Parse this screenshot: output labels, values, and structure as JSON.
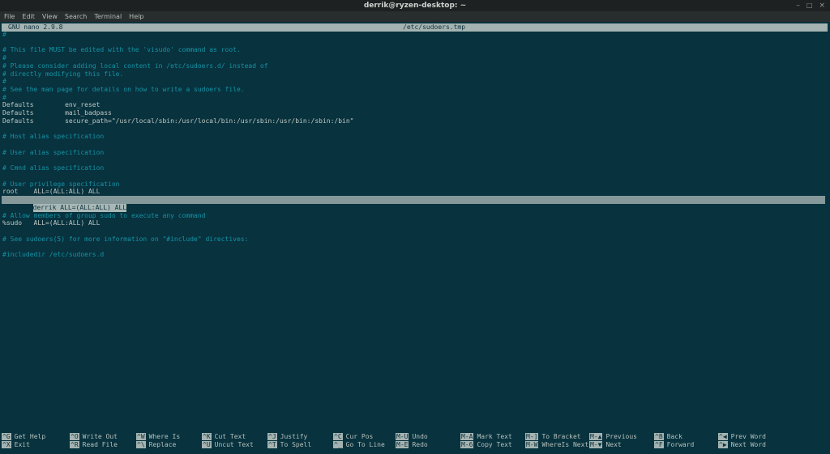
{
  "window": {
    "title": "derrik@ryzen-desktop: ~",
    "controls": {
      "minimize_icon": "–",
      "maximize_icon": "□",
      "close_icon": "×"
    }
  },
  "menu": {
    "items": [
      "File",
      "Edit",
      "View",
      "Search",
      "Terminal",
      "Help"
    ]
  },
  "palette": {
    "terminal-bg": "#07323e",
    "comment": "#1693a5",
    "text": "#c1c8c3",
    "bar-bg": "#a4b3b1",
    "bar-text": "#0f323c",
    "hl-row": "#85989a",
    "hl-text-bg": "#a8b8b6",
    "titlebar-bg": "#1d2121",
    "menubar-bg": "#282d2d"
  },
  "nano": {
    "version_label": "GNU nano 2.9.8",
    "filename": "/etc/sudoers.tmp",
    "current_line_index": 21,
    "lines": [
      {
        "text": "#",
        "kind": "comment"
      },
      {
        "text": "",
        "kind": "blank"
      },
      {
        "text": "# This file MUST be edited with the 'visudo' command as root.",
        "kind": "comment"
      },
      {
        "text": "#",
        "kind": "comment"
      },
      {
        "text": "# Please consider adding local content in /etc/sudoers.d/ instead of",
        "kind": "comment"
      },
      {
        "text": "# directly modifying this file.",
        "kind": "comment"
      },
      {
        "text": "#",
        "kind": "comment"
      },
      {
        "text": "# See the man page for details on how to write a sudoers file.",
        "kind": "comment"
      },
      {
        "text": "#",
        "kind": "comment"
      },
      {
        "text": "Defaults        env_reset",
        "kind": "plain"
      },
      {
        "text": "Defaults        mail_badpass",
        "kind": "plain"
      },
      {
        "text": "Defaults        secure_path=\"/usr/local/sbin:/usr/local/bin:/usr/sbin:/usr/bin:/sbin:/bin\"",
        "kind": "plain"
      },
      {
        "text": "",
        "kind": "blank"
      },
      {
        "text": "# Host alias specification",
        "kind": "comment"
      },
      {
        "text": "",
        "kind": "blank"
      },
      {
        "text": "# User alias specification",
        "kind": "comment"
      },
      {
        "text": "",
        "kind": "blank"
      },
      {
        "text": "# Cmnd alias specification",
        "kind": "comment"
      },
      {
        "text": "",
        "kind": "blank"
      },
      {
        "text": "# User privilege specification",
        "kind": "comment"
      },
      {
        "text": "root    ALL=(ALL:ALL) ALL",
        "kind": "plain"
      },
      {
        "text": "derrik ALL=(ALL:ALL) ALL",
        "kind": "highlight"
      },
      {
        "text": "",
        "kind": "blank"
      },
      {
        "text": "# Allow members of group sudo to execute any command",
        "kind": "comment"
      },
      {
        "text": "%sudo   ALL=(ALL:ALL) ALL",
        "kind": "plain"
      },
      {
        "text": "",
        "kind": "blank"
      },
      {
        "text": "# See sudoers(5) for more information on \"#include\" directives:",
        "kind": "comment"
      },
      {
        "text": "",
        "kind": "blank"
      },
      {
        "text": "#includedir /etc/sudoers.d",
        "kind": "comment"
      }
    ],
    "shortcuts": [
      {
        "top": {
          "key": "^G",
          "label": "Get Help"
        },
        "bottom": {
          "key": "^X",
          "label": "Exit"
        }
      },
      {
        "top": {
          "key": "^O",
          "label": "Write Out"
        },
        "bottom": {
          "key": "^R",
          "label": "Read File"
        }
      },
      {
        "top": {
          "key": "^W",
          "label": "Where Is"
        },
        "bottom": {
          "key": "^\\",
          "label": "Replace"
        }
      },
      {
        "top": {
          "key": "^K",
          "label": "Cut Text"
        },
        "bottom": {
          "key": "^U",
          "label": "Uncut Text"
        }
      },
      {
        "top": {
          "key": "^J",
          "label": "Justify"
        },
        "bottom": {
          "key": "^T",
          "label": "To Spell"
        }
      },
      {
        "top": {
          "key": "^C",
          "label": "Cur Pos"
        },
        "bottom": {
          "key": "^_",
          "label": "Go To Line"
        }
      },
      {
        "top": {
          "key": "M-U",
          "label": "Undo"
        },
        "bottom": {
          "key": "M-E",
          "label": "Redo"
        }
      },
      {
        "top": {
          "key": "M-A",
          "label": "Mark Text"
        },
        "bottom": {
          "key": "M-6",
          "label": "Copy Text"
        }
      },
      {
        "top": {
          "key": "M-]",
          "label": "To Bracket"
        },
        "bottom": {
          "key": "M-W",
          "label": "WhereIs Next"
        }
      },
      {
        "top": {
          "key": "M-▲",
          "label": "Previous"
        },
        "bottom": {
          "key": "M-▼",
          "label": "Next"
        }
      },
      {
        "top": {
          "key": "^B",
          "label": "Back"
        },
        "bottom": {
          "key": "^F",
          "label": "Forward"
        }
      },
      {
        "top": {
          "key": "^◀",
          "label": "Prev Word"
        },
        "bottom": {
          "key": "^▶",
          "label": "Next Word"
        }
      }
    ]
  }
}
